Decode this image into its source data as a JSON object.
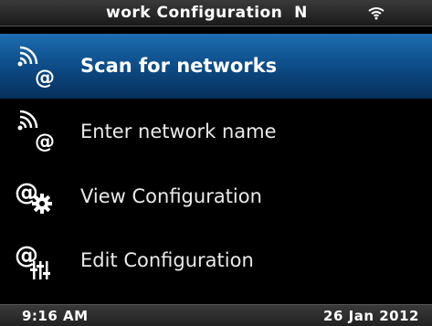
{
  "header": {
    "title": "work Configuration  N",
    "wifi_icon": "wifi-icon"
  },
  "menu": {
    "items": [
      {
        "label": "Scan for networks",
        "icon": "wireless-at-icon",
        "selected": true
      },
      {
        "label": "Enter network name",
        "icon": "wireless-at-icon",
        "selected": false
      },
      {
        "label": "View Configuration",
        "icon": "at-gear-icon",
        "selected": false
      },
      {
        "label": "Edit Configuration",
        "icon": "at-sliders-icon",
        "selected": false
      }
    ]
  },
  "status": {
    "time": "9:16 AM",
    "date": "26 Jan 2012"
  },
  "colors": {
    "selection": "#0e4f8c",
    "background": "#000000",
    "text": "#ffffff"
  }
}
